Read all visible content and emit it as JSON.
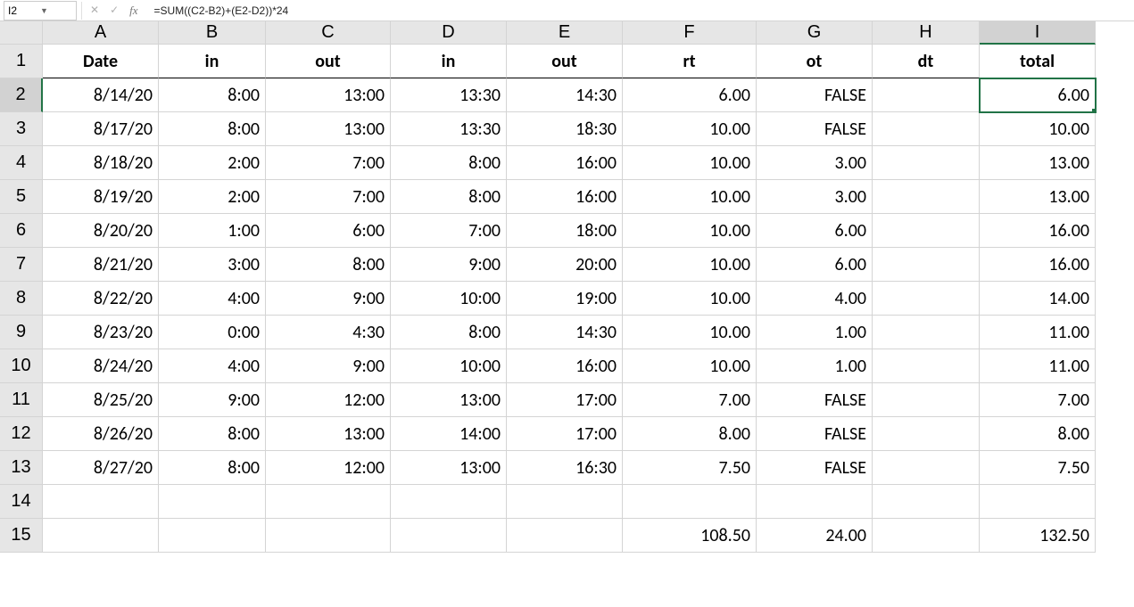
{
  "name_box": "I2",
  "formula": "=SUM((C2-B2)+(E2-D2))*24",
  "columns": [
    "A",
    "B",
    "C",
    "D",
    "E",
    "F",
    "G",
    "H",
    "I"
  ],
  "row_numbers": [
    "1",
    "2",
    "3",
    "4",
    "5",
    "6",
    "7",
    "8",
    "9",
    "10",
    "11",
    "12",
    "13",
    "14",
    "15"
  ],
  "headers": {
    "A": "Date",
    "B": "in",
    "C": "out",
    "D": "in",
    "E": "out",
    "F": "rt",
    "G": "ot",
    "H": "dt",
    "I": "total"
  },
  "rows": [
    {
      "A": "8/14/20",
      "B": "8:00",
      "C": "13:00",
      "D": "13:30",
      "E": "14:30",
      "F": "6.00",
      "G": "FALSE",
      "H": "",
      "I": "6.00",
      "red": false
    },
    {
      "A": "8/17/20",
      "B": "8:00",
      "C": "13:00",
      "D": "13:30",
      "E": "18:30",
      "F": "10.00",
      "G": "FALSE",
      "H": "",
      "I": "10.00",
      "red": false
    },
    {
      "A": "8/18/20",
      "B": "2:00",
      "C": "7:00",
      "D": "8:00",
      "E": "16:00",
      "F": "10.00",
      "G": "3.00",
      "H": "",
      "I": "13.00",
      "red": false
    },
    {
      "A": "8/19/20",
      "B": "2:00",
      "C": "7:00",
      "D": "8:00",
      "E": "16:00",
      "F": "10.00",
      "G": "3.00",
      "H": "",
      "I": "13.00",
      "red": false
    },
    {
      "A": "8/20/20",
      "B": "1:00",
      "C": "6:00",
      "D": "7:00",
      "E": "18:00",
      "F": "10.00",
      "G": "6.00",
      "H": "",
      "I": "16.00",
      "red": false
    },
    {
      "A": "8/21/20",
      "B": "3:00",
      "C": "8:00",
      "D": "9:00",
      "E": "20:00",
      "F": "10.00",
      "G": "6.00",
      "H": "",
      "I": "16.00",
      "red": false
    },
    {
      "A": "8/22/20",
      "B": "4:00",
      "C": "9:00",
      "D": "10:00",
      "E": "19:00",
      "F": "10.00",
      "G": "4.00",
      "H": "",
      "I": "14.00",
      "red": false
    },
    {
      "A": "8/23/20",
      "B": "0:00",
      "C": "4:30",
      "D": "8:00",
      "E": "14:30",
      "F": "10.00",
      "G": "1.00",
      "H": "",
      "I": "11.00",
      "red": true
    },
    {
      "A": "8/24/20",
      "B": "4:00",
      "C": "9:00",
      "D": "10:00",
      "E": "16:00",
      "F": "10.00",
      "G": "1.00",
      "H": "",
      "I": "11.00",
      "red": false
    },
    {
      "A": "8/25/20",
      "B": "9:00",
      "C": "12:00",
      "D": "13:00",
      "E": "17:00",
      "F": "7.00",
      "G": "FALSE",
      "H": "",
      "I": "7.00",
      "red": false
    },
    {
      "A": "8/26/20",
      "B": "8:00",
      "C": "13:00",
      "D": "14:00",
      "E": "17:00",
      "F": "8.00",
      "G": "FALSE",
      "H": "",
      "I": "8.00",
      "red": false
    },
    {
      "A": "8/27/20",
      "B": "8:00",
      "C": "12:00",
      "D": "13:00",
      "E": "16:30",
      "F": "7.50",
      "G": "FALSE",
      "H": "",
      "I": "7.50",
      "red": false
    }
  ],
  "empty_row": {
    "A": "",
    "B": "",
    "C": "",
    "D": "",
    "E": "",
    "F": "",
    "G": "",
    "H": "",
    "I": ""
  },
  "totals": {
    "A": "",
    "B": "",
    "C": "",
    "D": "",
    "E": "",
    "F": "108.50",
    "G": "24.00",
    "H": "",
    "I": "132.50"
  },
  "selected_cell": {
    "row": 2,
    "col": "I"
  }
}
